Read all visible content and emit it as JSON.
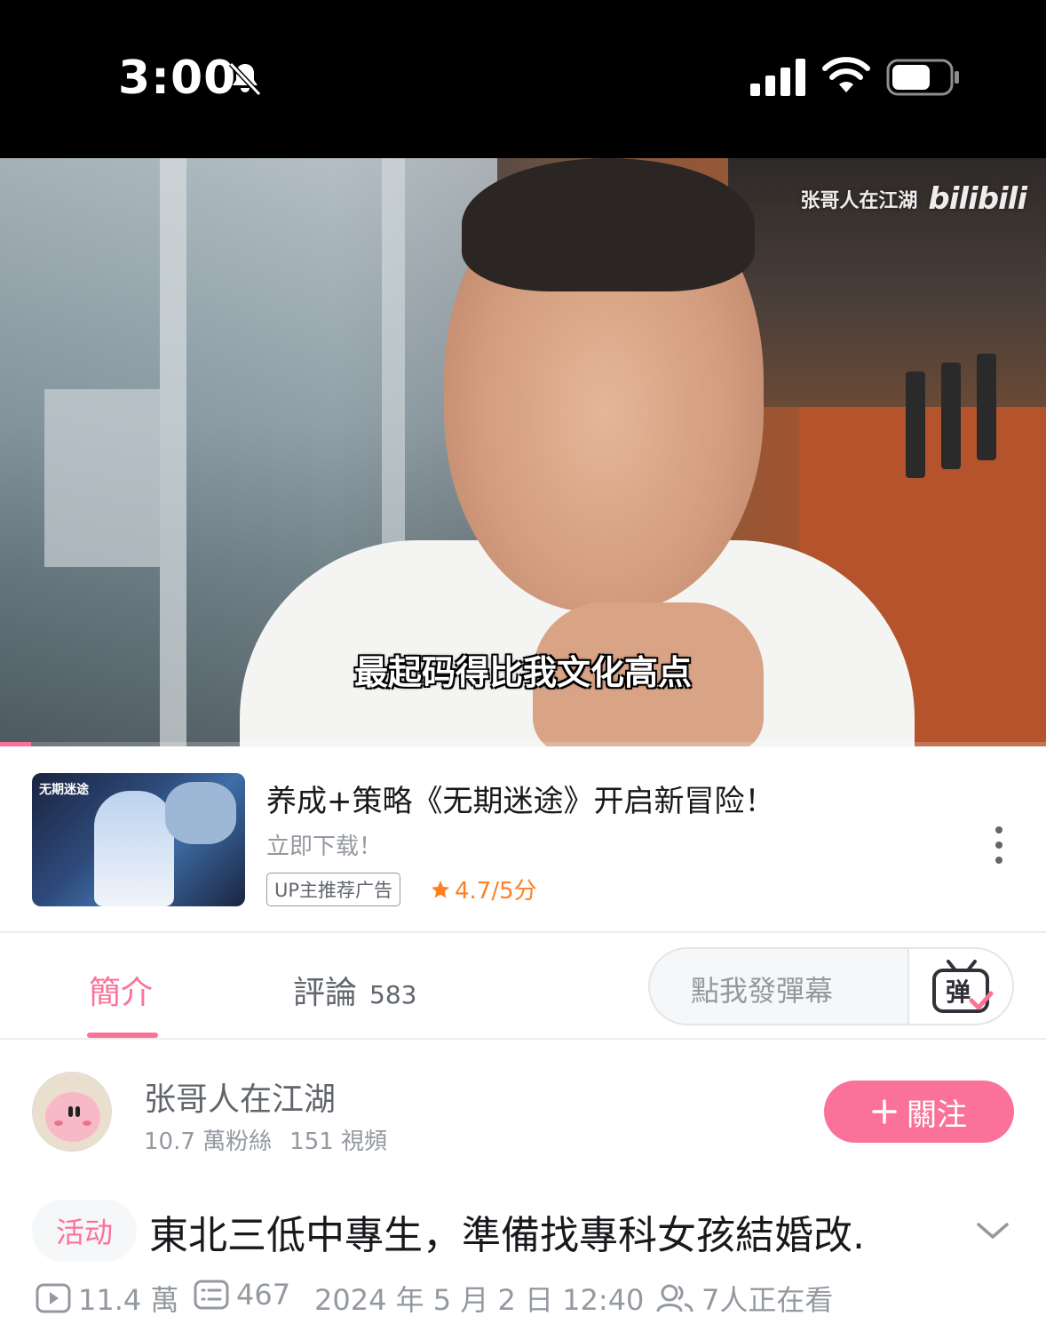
{
  "status_bar": {
    "time": "3:00"
  },
  "video": {
    "watermark_text": "张哥人在江湖",
    "watermark_logo": "bilibili",
    "subtitle": "最起码得比我文化高点",
    "progress_fraction": 0.03
  },
  "ad": {
    "thumb_logo": "无期迷途",
    "title": "养成+策略《无期迷途》开启新冒险！",
    "subtitle": "立即下载！",
    "tag": "UP主推荐广告",
    "rating": "4.7/5分"
  },
  "tabs": {
    "intro_label": "簡介",
    "comments_label": "評論",
    "comments_count": "583",
    "danmaku_placeholder": "點我發彈幕",
    "danmaku_button_glyph": "弹"
  },
  "uploader": {
    "name": "张哥人在江湖",
    "followers": "10.7 萬粉絲",
    "videos": "151 視頻",
    "follow_label": "關注"
  },
  "video_info": {
    "activity_tag": "活动",
    "title": "東北三低中專生，準備找專科女孩結婚改.",
    "views": "11.4 萬",
    "danmaku_count": "467",
    "date": "2024 年 5 月 2 日 12:40",
    "watching": "7人正在看"
  },
  "colors": {
    "accent": "#fb7299",
    "rating": "#ff7f24",
    "muted": "#9499a0"
  }
}
